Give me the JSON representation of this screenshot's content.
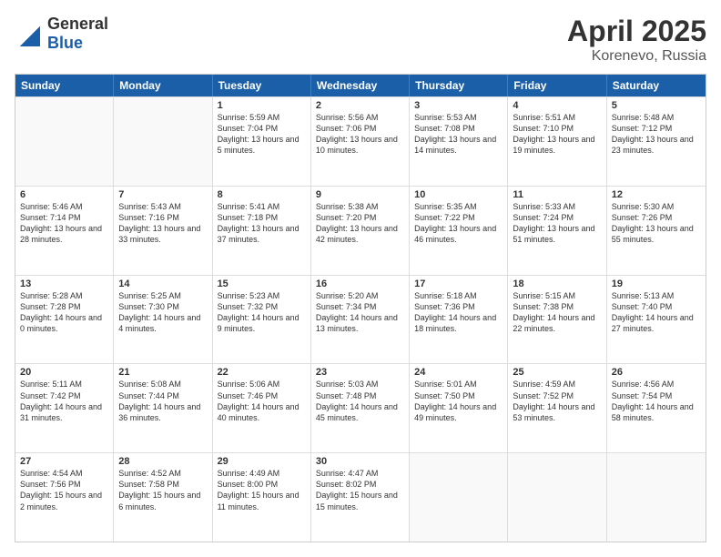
{
  "logo": {
    "general": "General",
    "blue": "Blue"
  },
  "title": {
    "month": "April 2025",
    "location": "Korenevo, Russia"
  },
  "header_days": [
    "Sunday",
    "Monday",
    "Tuesday",
    "Wednesday",
    "Thursday",
    "Friday",
    "Saturday"
  ],
  "weeks": [
    [
      {
        "day": "",
        "info": ""
      },
      {
        "day": "",
        "info": ""
      },
      {
        "day": "1",
        "info": "Sunrise: 5:59 AM\nSunset: 7:04 PM\nDaylight: 13 hours and 5 minutes."
      },
      {
        "day": "2",
        "info": "Sunrise: 5:56 AM\nSunset: 7:06 PM\nDaylight: 13 hours and 10 minutes."
      },
      {
        "day": "3",
        "info": "Sunrise: 5:53 AM\nSunset: 7:08 PM\nDaylight: 13 hours and 14 minutes."
      },
      {
        "day": "4",
        "info": "Sunrise: 5:51 AM\nSunset: 7:10 PM\nDaylight: 13 hours and 19 minutes."
      },
      {
        "day": "5",
        "info": "Sunrise: 5:48 AM\nSunset: 7:12 PM\nDaylight: 13 hours and 23 minutes."
      }
    ],
    [
      {
        "day": "6",
        "info": "Sunrise: 5:46 AM\nSunset: 7:14 PM\nDaylight: 13 hours and 28 minutes."
      },
      {
        "day": "7",
        "info": "Sunrise: 5:43 AM\nSunset: 7:16 PM\nDaylight: 13 hours and 33 minutes."
      },
      {
        "day": "8",
        "info": "Sunrise: 5:41 AM\nSunset: 7:18 PM\nDaylight: 13 hours and 37 minutes."
      },
      {
        "day": "9",
        "info": "Sunrise: 5:38 AM\nSunset: 7:20 PM\nDaylight: 13 hours and 42 minutes."
      },
      {
        "day": "10",
        "info": "Sunrise: 5:35 AM\nSunset: 7:22 PM\nDaylight: 13 hours and 46 minutes."
      },
      {
        "day": "11",
        "info": "Sunrise: 5:33 AM\nSunset: 7:24 PM\nDaylight: 13 hours and 51 minutes."
      },
      {
        "day": "12",
        "info": "Sunrise: 5:30 AM\nSunset: 7:26 PM\nDaylight: 13 hours and 55 minutes."
      }
    ],
    [
      {
        "day": "13",
        "info": "Sunrise: 5:28 AM\nSunset: 7:28 PM\nDaylight: 14 hours and 0 minutes."
      },
      {
        "day": "14",
        "info": "Sunrise: 5:25 AM\nSunset: 7:30 PM\nDaylight: 14 hours and 4 minutes."
      },
      {
        "day": "15",
        "info": "Sunrise: 5:23 AM\nSunset: 7:32 PM\nDaylight: 14 hours and 9 minutes."
      },
      {
        "day": "16",
        "info": "Sunrise: 5:20 AM\nSunset: 7:34 PM\nDaylight: 14 hours and 13 minutes."
      },
      {
        "day": "17",
        "info": "Sunrise: 5:18 AM\nSunset: 7:36 PM\nDaylight: 14 hours and 18 minutes."
      },
      {
        "day": "18",
        "info": "Sunrise: 5:15 AM\nSunset: 7:38 PM\nDaylight: 14 hours and 22 minutes."
      },
      {
        "day": "19",
        "info": "Sunrise: 5:13 AM\nSunset: 7:40 PM\nDaylight: 14 hours and 27 minutes."
      }
    ],
    [
      {
        "day": "20",
        "info": "Sunrise: 5:11 AM\nSunset: 7:42 PM\nDaylight: 14 hours and 31 minutes."
      },
      {
        "day": "21",
        "info": "Sunrise: 5:08 AM\nSunset: 7:44 PM\nDaylight: 14 hours and 36 minutes."
      },
      {
        "day": "22",
        "info": "Sunrise: 5:06 AM\nSunset: 7:46 PM\nDaylight: 14 hours and 40 minutes."
      },
      {
        "day": "23",
        "info": "Sunrise: 5:03 AM\nSunset: 7:48 PM\nDaylight: 14 hours and 45 minutes."
      },
      {
        "day": "24",
        "info": "Sunrise: 5:01 AM\nSunset: 7:50 PM\nDaylight: 14 hours and 49 minutes."
      },
      {
        "day": "25",
        "info": "Sunrise: 4:59 AM\nSunset: 7:52 PM\nDaylight: 14 hours and 53 minutes."
      },
      {
        "day": "26",
        "info": "Sunrise: 4:56 AM\nSunset: 7:54 PM\nDaylight: 14 hours and 58 minutes."
      }
    ],
    [
      {
        "day": "27",
        "info": "Sunrise: 4:54 AM\nSunset: 7:56 PM\nDaylight: 15 hours and 2 minutes."
      },
      {
        "day": "28",
        "info": "Sunrise: 4:52 AM\nSunset: 7:58 PM\nDaylight: 15 hours and 6 minutes."
      },
      {
        "day": "29",
        "info": "Sunrise: 4:49 AM\nSunset: 8:00 PM\nDaylight: 15 hours and 11 minutes."
      },
      {
        "day": "30",
        "info": "Sunrise: 4:47 AM\nSunset: 8:02 PM\nDaylight: 15 hours and 15 minutes."
      },
      {
        "day": "",
        "info": ""
      },
      {
        "day": "",
        "info": ""
      },
      {
        "day": "",
        "info": ""
      }
    ]
  ]
}
